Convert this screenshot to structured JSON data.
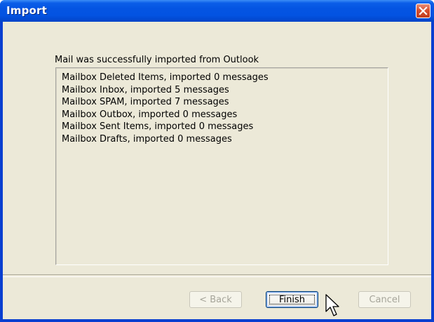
{
  "window": {
    "title": "Import"
  },
  "message": "Mail was successfully imported from Outlook",
  "results": [
    "Mailbox Deleted Items, imported 0 messages",
    "Mailbox Inbox, imported 5 messages",
    "Mailbox SPAM, imported 7 messages",
    "Mailbox Outbox, imported 0 messages",
    "Mailbox Sent Items, imported 0 messages",
    "Mailbox Drafts, imported 0 messages"
  ],
  "buttons": {
    "back": "< Back",
    "finish": "Finish",
    "cancel": "Cancel"
  },
  "icons": {
    "close": "close-icon",
    "cursor": "mouse-pointer-icon"
  },
  "colors": {
    "titlebar": "#0454e2",
    "client": "#ece9d8",
    "close_button": "#d8502f"
  }
}
